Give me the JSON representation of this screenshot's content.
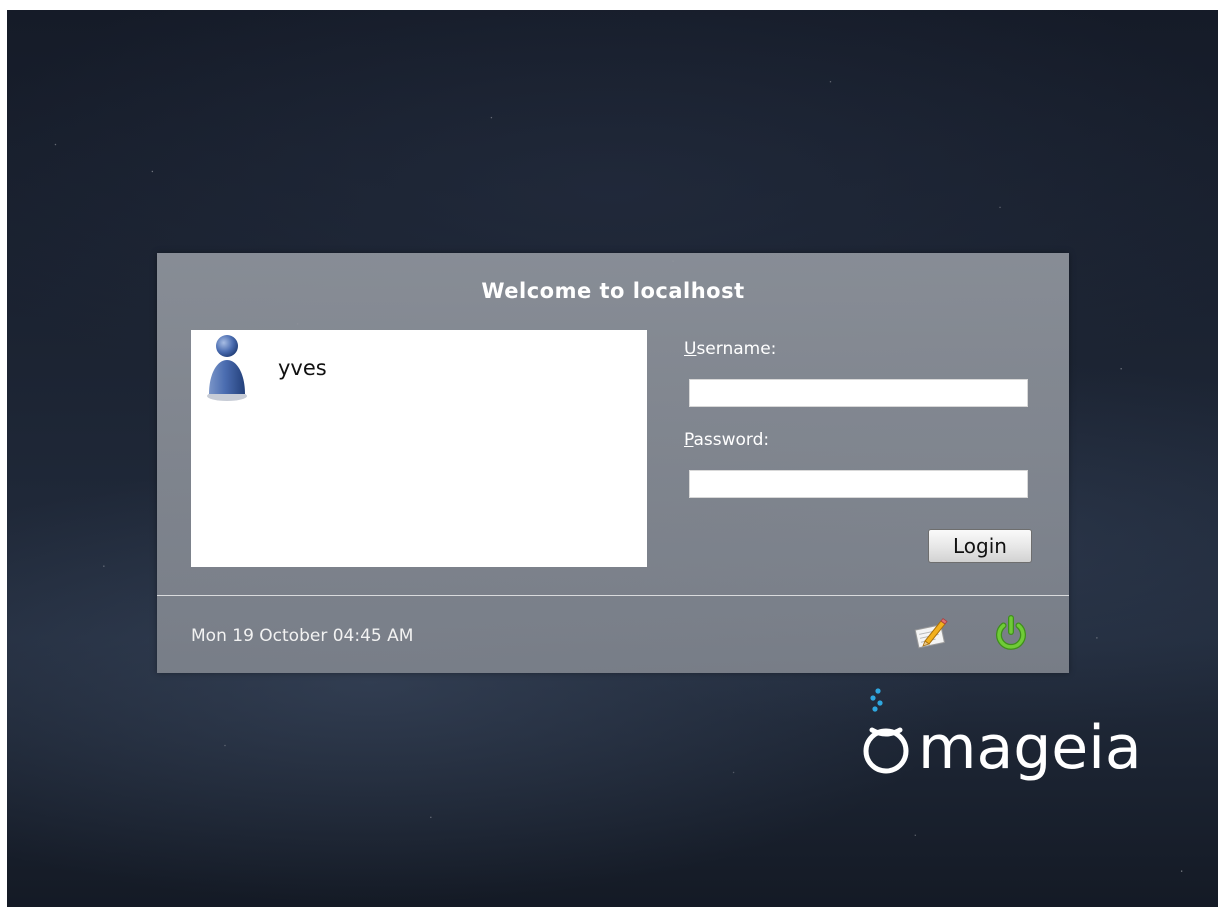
{
  "login_panel": {
    "title": "Welcome to localhost",
    "users": [
      {
        "name": "yves"
      }
    ],
    "username": {
      "label_mnemonic": "U",
      "label_rest": "sername:",
      "value": ""
    },
    "password": {
      "label_mnemonic": "P",
      "label_rest": "assword:",
      "value": ""
    },
    "login_button_label": "Login",
    "datetime": "Mon 19 October 04:45 AM"
  },
  "footer_icons": {
    "session": "session-edit-icon",
    "power": "power-icon"
  },
  "brand": {
    "name": "mageia"
  },
  "colors": {
    "power_green": "#5ab52c",
    "logo_blue": "#2fa8e0",
    "user_icon_blue": "#3d5fa0"
  }
}
